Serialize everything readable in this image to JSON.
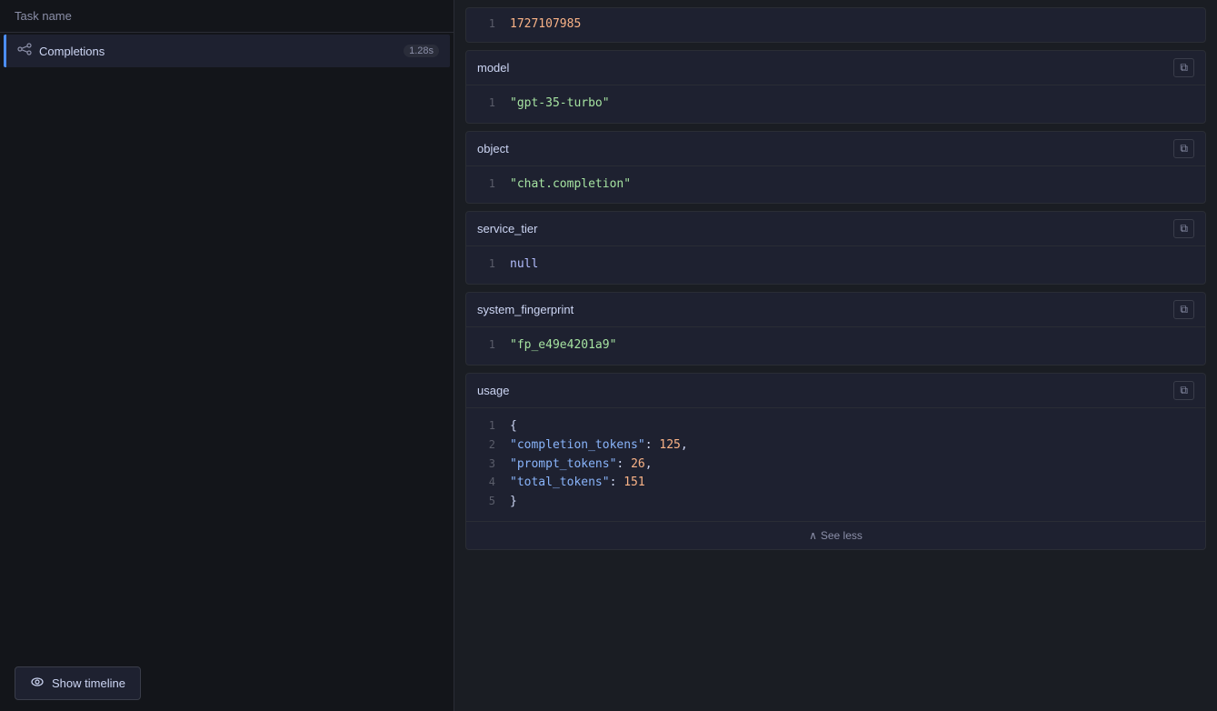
{
  "sidebar": {
    "header": "Task name",
    "item": {
      "icon": "⛓",
      "label": "Completions",
      "badge": "1.28s"
    },
    "footer_button": "Show timeline"
  },
  "main": {
    "top_line": {
      "line_num": "1",
      "value": "1727107985",
      "color": "number"
    },
    "fields": [
      {
        "id": "model",
        "name": "model",
        "lines": [
          {
            "num": "1",
            "content": "\"gpt-35-turbo\"",
            "type": "string"
          }
        ]
      },
      {
        "id": "object",
        "name": "object",
        "lines": [
          {
            "num": "1",
            "content": "\"chat.completion\"",
            "type": "string"
          }
        ]
      },
      {
        "id": "service_tier",
        "name": "service_tier",
        "lines": [
          {
            "num": "1",
            "content": "null",
            "type": "null"
          }
        ]
      },
      {
        "id": "system_fingerprint",
        "name": "system_fingerprint",
        "lines": [
          {
            "num": "1",
            "content": "\"fp_e49e4201a9\"",
            "type": "string"
          }
        ]
      },
      {
        "id": "usage",
        "name": "usage",
        "is_object": true,
        "lines": [
          {
            "num": "1",
            "content": "{",
            "type": "brace"
          },
          {
            "num": "2",
            "key": "\"completion_tokens\"",
            "colon": ": ",
            "value": "125",
            "value_type": "number",
            "comma": ","
          },
          {
            "num": "3",
            "key": "\"prompt_tokens\"",
            "colon": ": ",
            "value": "26",
            "value_type": "number",
            "comma": ","
          },
          {
            "num": "4",
            "key": "\"total_tokens\"",
            "colon": ": ",
            "value": "151",
            "value_type": "number",
            "comma": ""
          },
          {
            "num": "5",
            "content": "}",
            "type": "brace"
          }
        ],
        "see_less": "See less"
      }
    ],
    "copy_icon": "⧉"
  }
}
